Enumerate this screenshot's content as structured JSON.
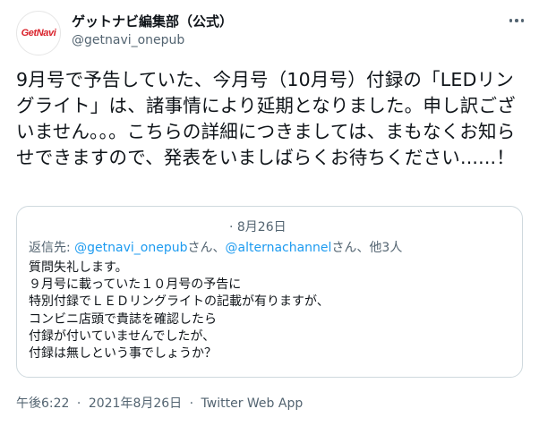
{
  "author": {
    "avatar_logo_text": "GetNavi",
    "display_name": "ゲットナビ編集部（公式）",
    "handle": "@getnavi_onepub",
    "brand_color": "#d9212a"
  },
  "more_icon": "more-horizontal-icon",
  "tweet": {
    "text": "9月号で予告していた、今月号（10月号）付録の「LEDリングライト」は、諸事情により延期となりました。申し訳ございません。。。こちらの詳細につきましては、まもなくお知らせできますので、発表をいましばらくお待ちください......！"
  },
  "quoted_tweet": {
    "date": "· 8月26日",
    "reply_prefix": "返信先: ",
    "reply_mention_1": "@getnavi_onepub",
    "reply_sep_1": "さん、",
    "reply_mention_2": "@alternachannel",
    "reply_sep_2": "さん、",
    "reply_others": "他3人",
    "body": "質問失礼します。\n９月号に載っていた１０月号の予告に\n特別付録でＬＥＤリングライトの記載が有りますが、\nコンビニ店頭で貴誌を確認したら\n付録が付いていませんでしたが、\n付録は無しという事でしょうか？"
  },
  "footer": {
    "time": "午後6:22",
    "separator": "·",
    "date": "2021年8月26日",
    "source": "Twitter Web App"
  },
  "colors": {
    "text": "#0f1419",
    "secondary": "#536471",
    "link": "#1d9bf0",
    "border": "#cfd9de"
  }
}
